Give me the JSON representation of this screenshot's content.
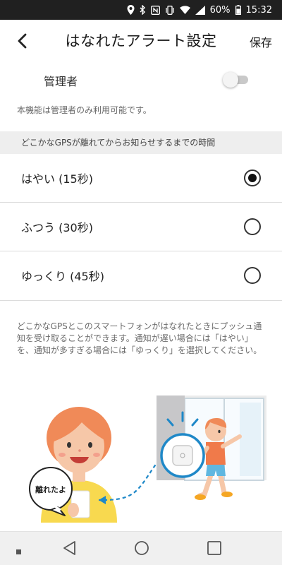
{
  "status_bar": {
    "battery_percent": "60%",
    "time": "15:32",
    "icons": [
      "location-icon",
      "bluetooth-icon",
      "nfc-icon",
      "vibrate-icon",
      "wifi-icon",
      "signal-icon",
      "battery-icon"
    ]
  },
  "header": {
    "title": "はなれたアラート設定",
    "save_label": "保存",
    "back_icon": "back-chevron-icon"
  },
  "admin": {
    "label": "管理者",
    "toggle_on": false,
    "note": "本機能は管理者のみ利用可能です。"
  },
  "section": {
    "header": "どこかなGPSが離れてからお知らせするまでの時間"
  },
  "options": [
    {
      "label": "はやい (15秒)",
      "selected": true
    },
    {
      "label": "ふつう (30秒)",
      "selected": false
    },
    {
      "label": "ゆっくり (45秒)",
      "selected": false
    }
  ],
  "description": "どこかなGPSとこのスマートフォンがはなれたときにプッシュ通知を受け取ることができます。通知が遅い場合には「はやい」を、通知が多すぎる場合には「ゆっくり」を選択してください。",
  "illustration": {
    "speech_bubble": "離れたよ"
  },
  "nav": {
    "icons": [
      "recents-dot-icon",
      "back-triangle-icon",
      "home-circle-icon",
      "overview-square-icon"
    ]
  },
  "colors": {
    "accent_blue": "#1e88c8",
    "skin": "#f6c7a8",
    "hair": "#f08a58",
    "shirt_yellow": "#f8d94f",
    "kid_shirt": "#f07a4a",
    "kid_shorts": "#5fb7e0"
  }
}
